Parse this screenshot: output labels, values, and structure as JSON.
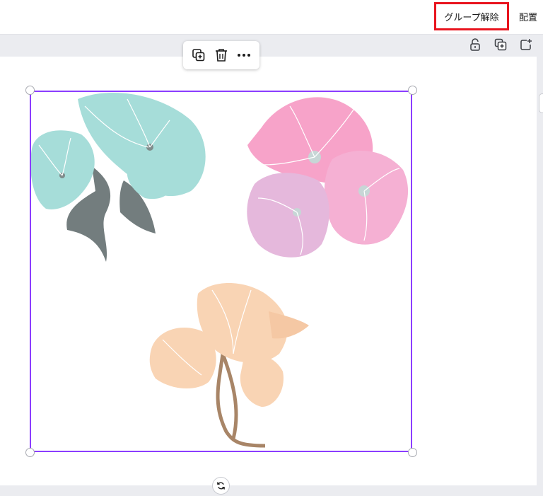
{
  "topbar": {
    "ungroup_label": "グループ解除",
    "arrange_label": "配置"
  },
  "page_toolbar": {
    "icons": [
      "lock-icon",
      "duplicate-page-icon",
      "add-page-icon"
    ]
  },
  "floating_toolbar": {
    "icons": [
      "copy-icon",
      "trash-icon",
      "more-icon"
    ]
  },
  "colors": {
    "selection": "#8b3dff",
    "highlight": "#e8141e",
    "teal_flower": "#a6ddd9",
    "pink_flower": "#f7a3c9",
    "lilac_flower": "#e5b8dc",
    "peach_flower": "#f9d4b4",
    "leaf_gray": "#737d7e",
    "stem_brown": "#a88567"
  }
}
